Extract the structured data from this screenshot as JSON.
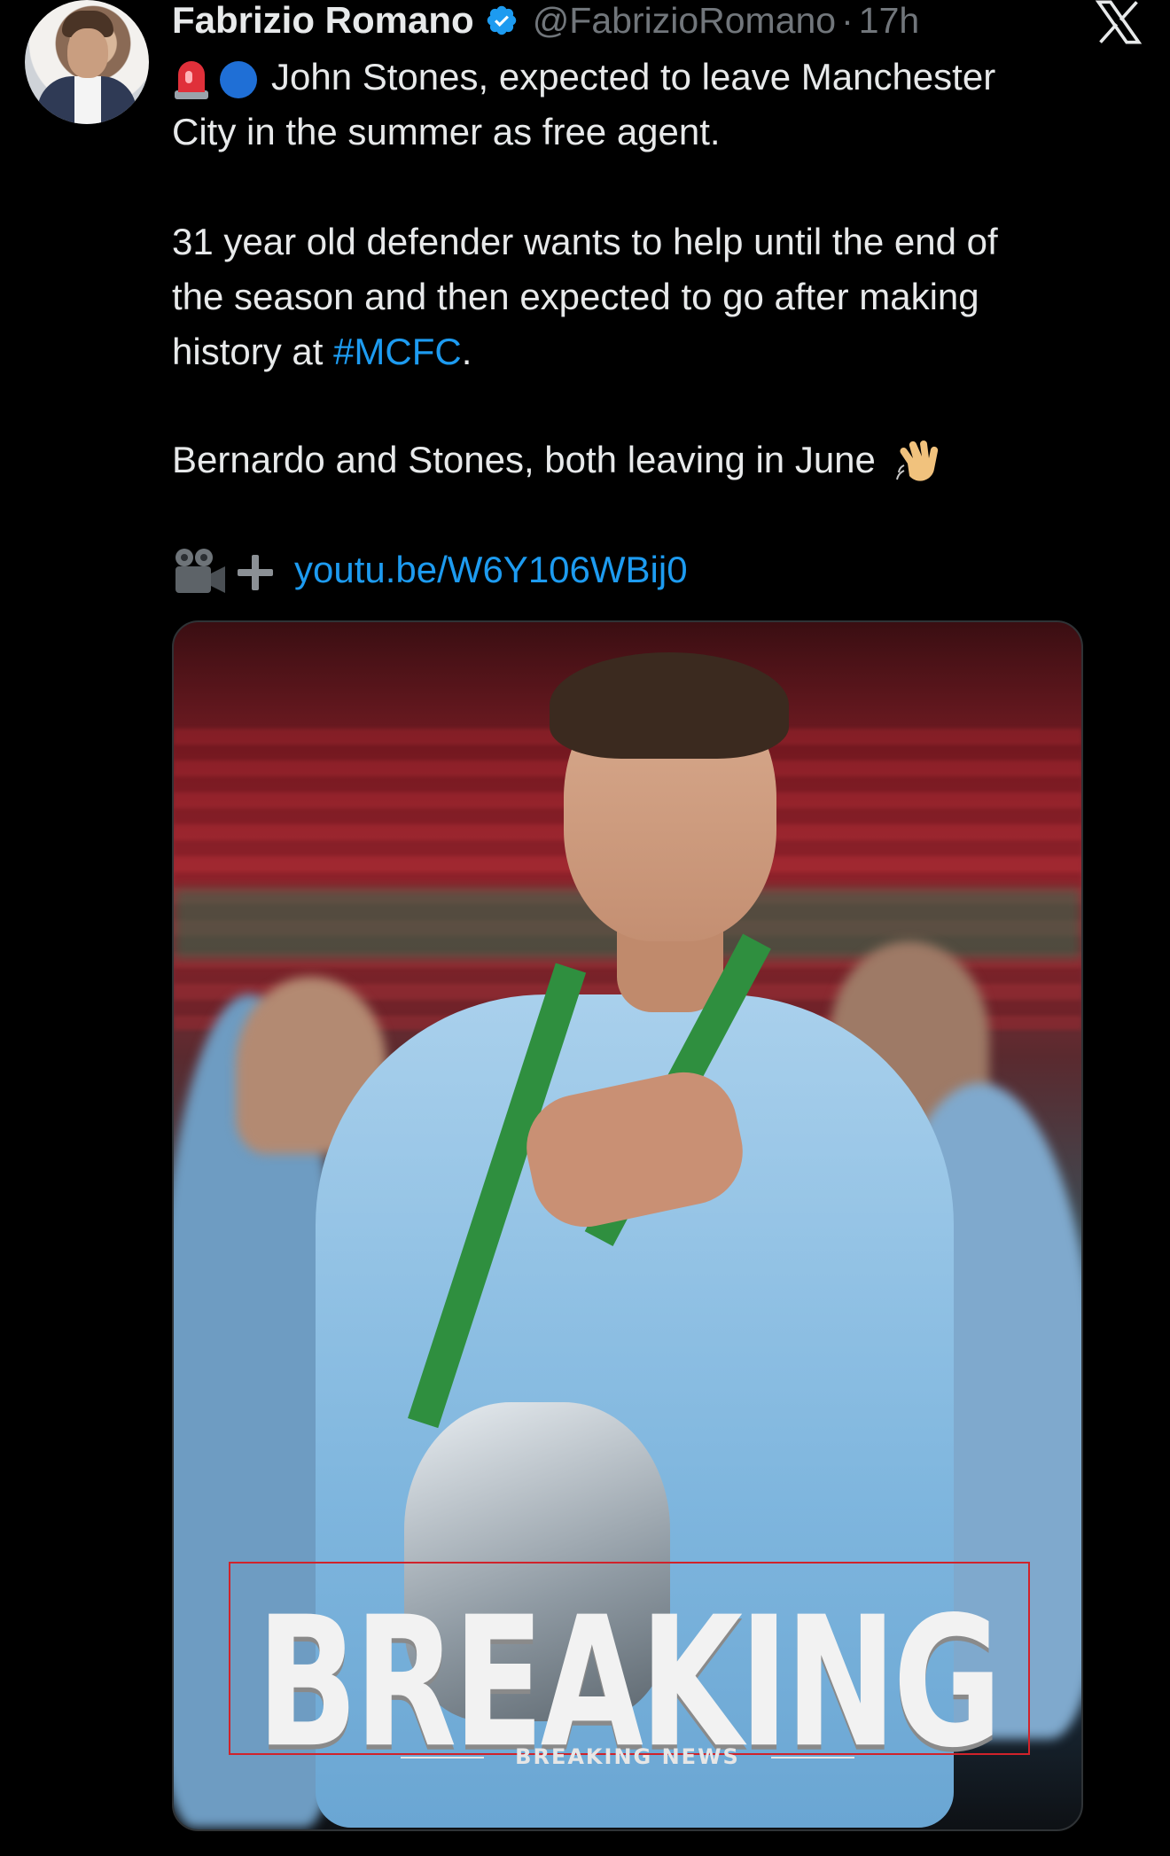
{
  "tweet": {
    "author_name": "Fabrizio Romano",
    "handle": "@FabrizioRomano",
    "separator": "·",
    "time": "17h",
    "lines": [
      "John Stones, expected to leave Manchester",
      "City in the summer as free agent.",
      "31 year old defender wants to help until the end of",
      "the season and then expected to go after making",
      "history at ",
      "#MCFC",
      ".",
      "Bernardo and Stones, both leaving in June"
    ],
    "link": "youtu.be/W6Y106WBij0",
    "icons": [
      "siren-emoji-icon",
      "blue-circle-emoji-icon",
      "waving-hand-emoji-icon",
      "video-camera-emoji-icon",
      "plus-icon",
      "verified-badge-icon",
      "x-logo-icon"
    ],
    "colors": {
      "accent": "#1d9bf0",
      "text": "#e7e9ea",
      "muted": "#71767b",
      "background": "#000000",
      "breaking_red": "#d0232b"
    }
  },
  "media": {
    "headline": "BREAKING",
    "subheadline": "BREAKING NEWS"
  }
}
